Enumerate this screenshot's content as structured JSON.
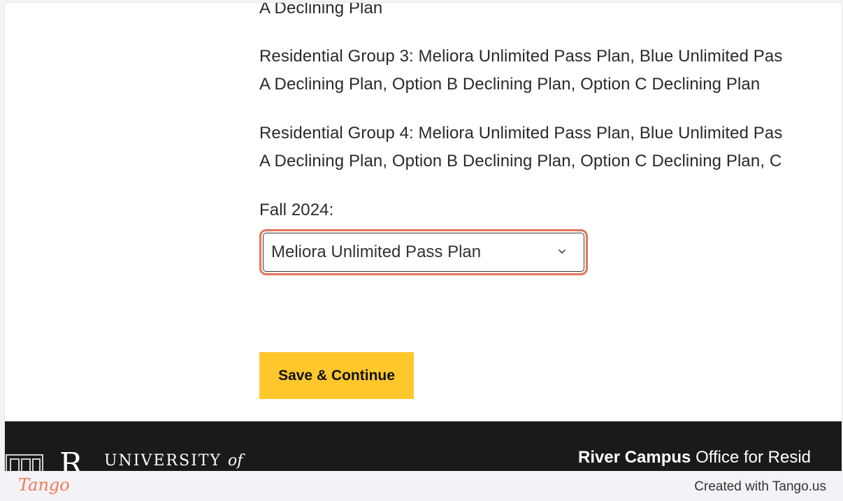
{
  "content": {
    "lines": [
      "A Declining Plan",
      "Residential Group 3: Meliora Unlimited Pass Plan, Blue Unlimited Pas",
      "A Declining Plan, Option B Declining Plan, Option C Declining Plan",
      "Residential Group 4: Meliora Unlimited Pass Plan, Blue Unlimited Pas",
      "A Declining Plan, Option B Declining Plan, Option C Declining Plan, C"
    ],
    "term_label": "Fall 2024:",
    "meal_plan_select": {
      "selected": "Meliora Unlimited Pass Plan"
    },
    "save_button": "Save & Continue"
  },
  "footer": {
    "university_text": "UNIVERSITY",
    "university_of": "of",
    "university_initial": "R",
    "office_bold": "River Campus",
    "office_rest": "Office for Resid"
  },
  "tango": {
    "logo": "Tango",
    "created": "Created with Tango.us"
  },
  "colors": {
    "accent": "#ffc72c",
    "highlight": "#e8725a",
    "footer_bg": "#1a1a1a",
    "tango": "#f07a5a"
  }
}
